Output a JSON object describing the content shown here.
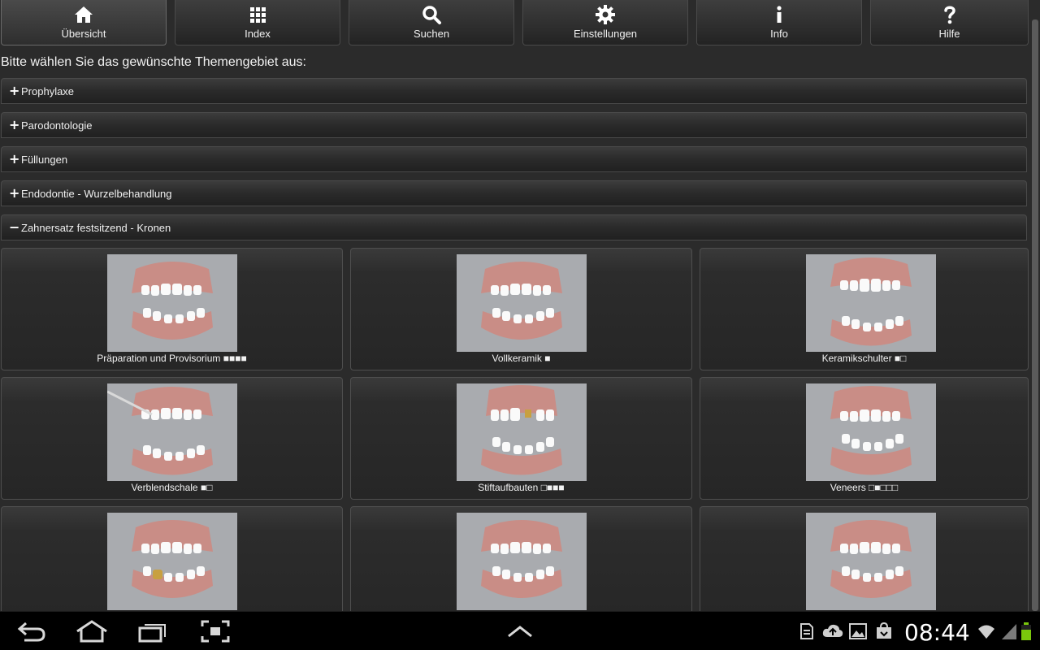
{
  "toolbar": {
    "buttons": [
      {
        "label": "Übersicht",
        "icon": "home-icon"
      },
      {
        "label": "Index",
        "icon": "grid-icon"
      },
      {
        "label": "Suchen",
        "icon": "search-icon"
      },
      {
        "label": "Einstellungen",
        "icon": "gear-icon"
      },
      {
        "label": "Info",
        "icon": "info-icon"
      },
      {
        "label": "Hilfe",
        "icon": "help-icon"
      }
    ]
  },
  "prompt": "Bitte wählen Sie das gewünschte Themengebiet aus:",
  "sections": [
    {
      "label": "Prophylaxe",
      "sign": "+",
      "expanded": false
    },
    {
      "label": "Parodontologie",
      "sign": "+",
      "expanded": false
    },
    {
      "label": "Füllungen",
      "sign": "+",
      "expanded": false
    },
    {
      "label": "Endodontie - Wurzelbehandlung",
      "sign": "+",
      "expanded": false
    },
    {
      "label": "Zahnersatz festsitzend - Kronen",
      "sign": "−",
      "expanded": true
    }
  ],
  "tiles": [
    {
      "caption": "Präparation und Provisorium ■■■■"
    },
    {
      "caption": "Vollkeramik ■"
    },
    {
      "caption": "Keramikschulter ■□"
    },
    {
      "caption": "Verblendschale ■□"
    },
    {
      "caption": "Stiftaufbauten □■■■"
    },
    {
      "caption": "Veneers □■□□□"
    },
    {
      "caption": ""
    },
    {
      "caption": ""
    },
    {
      "caption": ""
    }
  ],
  "statusbar": {
    "time": "08:44"
  },
  "colors": {
    "background": "#2b2b2b",
    "toolbar": "#333333",
    "navbar": "#000000",
    "battery": "#7ac70c"
  }
}
